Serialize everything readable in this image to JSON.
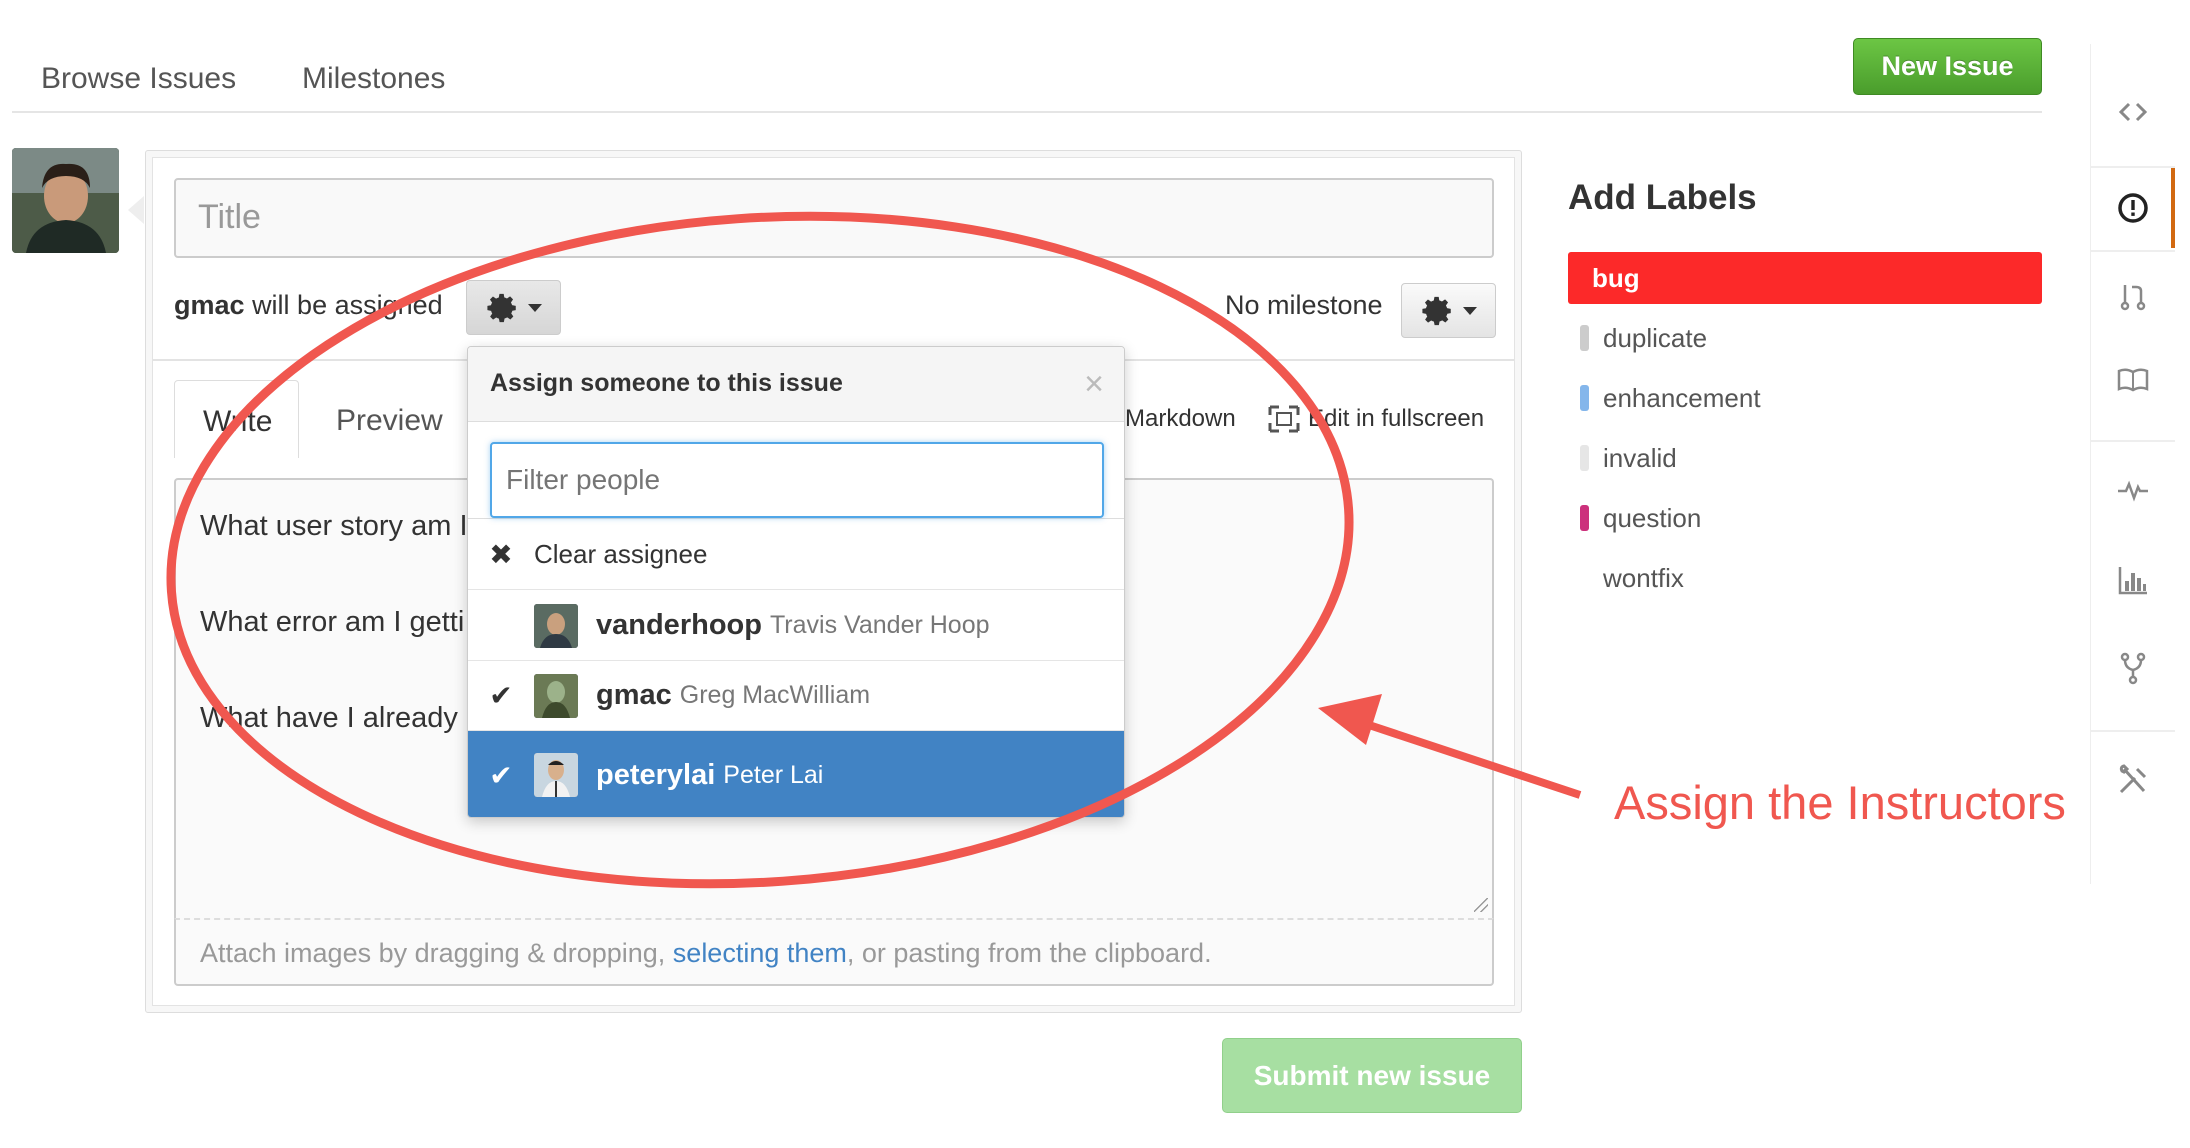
{
  "nav": {
    "browse_issues": "Browse Issues",
    "milestones": "Milestones",
    "new_issue": "New Issue"
  },
  "form": {
    "title_placeholder": "Title",
    "assign_user": "gmac",
    "assign_text": "will be assigned",
    "milestone_text": "No milestone",
    "tabs": {
      "write": "Write",
      "preview": "Preview"
    },
    "markdown_link": "Markdown",
    "fullscreen_link": "Edit in fullscreen",
    "body_lines": [
      "What user story am I",
      "What error am I getti",
      "What have I already"
    ],
    "attach": {
      "before": "Attach images by dragging & dropping, ",
      "link": "selecting them",
      "after": ", or pasting from the clipboard."
    },
    "submit": "Submit new issue"
  },
  "dropdown": {
    "title": "Assign someone to this issue",
    "filter_placeholder": "Filter people",
    "clear": "Clear assignee",
    "people": [
      {
        "login": "vanderhoop",
        "name": "Travis Vander Hoop",
        "checked": false
      },
      {
        "login": "gmac",
        "name": "Greg MacWilliam",
        "checked": true
      },
      {
        "login": "peterylai",
        "name": "Peter Lai",
        "checked": true
      }
    ]
  },
  "labels": {
    "title": "Add Labels",
    "items": [
      {
        "name": "bug",
        "color": "#fc2929"
      },
      {
        "name": "duplicate",
        "color": "#cccccc"
      },
      {
        "name": "enhancement",
        "color": "#84b6eb"
      },
      {
        "name": "invalid",
        "color": "#e6e6e6"
      },
      {
        "name": "question",
        "color": "#cc317c"
      },
      {
        "name": "wontfix",
        "color": "#ffffff"
      }
    ]
  },
  "repo_nav_icons": [
    "code-icon",
    "issues-icon",
    "pull-request-icon",
    "wiki-icon",
    "pulse-icon",
    "graphs-icon",
    "network-icon",
    "settings-icon"
  ],
  "annotation": {
    "text": "Assign the Instructors",
    "color": "#f0574f"
  }
}
